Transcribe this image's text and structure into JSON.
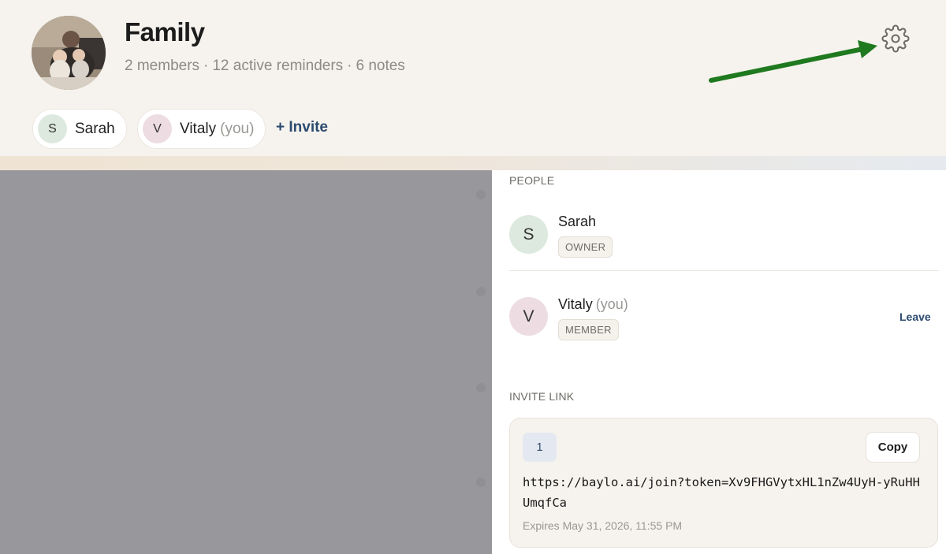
{
  "group": {
    "name": "Family",
    "stats": [
      "2 members",
      "12 active reminders",
      "6 notes"
    ],
    "separator": "·"
  },
  "chips": [
    {
      "initial": "S",
      "name": "Sarah",
      "suffix": "",
      "color": "#dde9df"
    },
    {
      "initial": "V",
      "name": "Vitaly",
      "suffix": "(you)",
      "color": "#eddde3"
    }
  ],
  "invite_label": "+ Invite",
  "panel": {
    "people_label": "PEOPLE",
    "people": [
      {
        "initial": "S",
        "name": "Sarah",
        "suffix": "",
        "role": "OWNER",
        "color": "#dde9df",
        "action": ""
      },
      {
        "initial": "V",
        "name": "Vitaly",
        "suffix": "(you)",
        "role": "MEMBER",
        "color": "#eddde3",
        "action": "Leave"
      }
    ],
    "invite_link_label": "INVITE LINK",
    "link": {
      "number": "1",
      "copy_label": "Copy",
      "url": "https://baylo.ai/join?token=Xv9FHGVytxHL1nZw4UyH-yRuHHUmqfCa",
      "expires": "Expires May 31, 2026, 11:55 PM"
    }
  },
  "icons": {
    "settings": "gear-icon",
    "annotation": "arrow-icon"
  },
  "colors": {
    "accent": "#2b4a6f",
    "annotation_arrow": "#1f7a1f",
    "header_bg": "#f6f3ee",
    "overlay": "#98979c"
  }
}
